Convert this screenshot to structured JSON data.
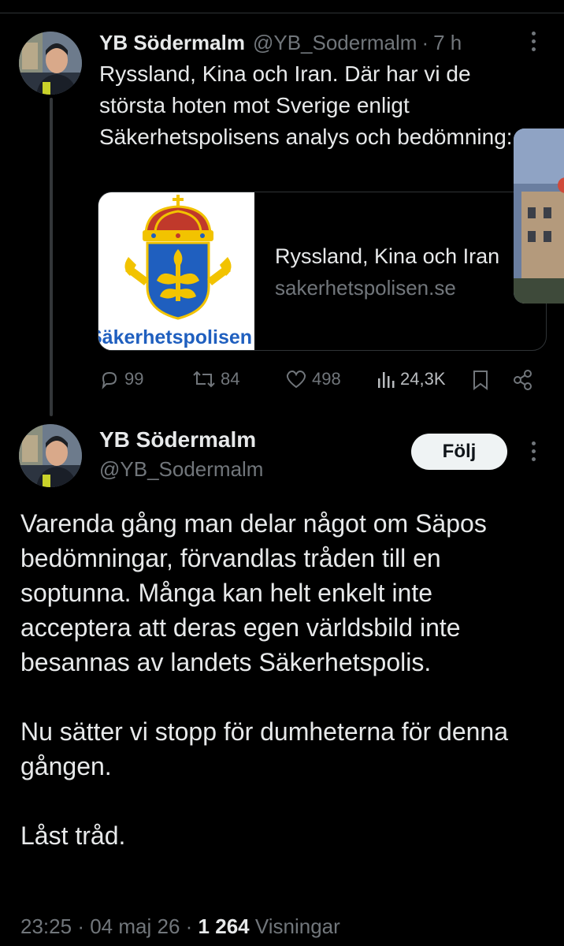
{
  "first_tweet": {
    "author_name": "YB Södermalm",
    "author_handle": "@YB_Sodermalm",
    "separator": "·",
    "time": "7 h",
    "text": "Ryssland, Kina och Iran. Där har vi de största hoten mot Sverige enligt Säkerhetspolisens analys och bedömning:",
    "card": {
      "title": "Ryssland, Kina och Iran",
      "domain": "sakerhetspolisen.se",
      "logo_text": "Säkerhetspolisen",
      "logo_colors": {
        "crown": "#c0392b",
        "gold": "#f2c300",
        "shield": "#1f5fbf"
      }
    },
    "actions": {
      "replies": "99",
      "reposts": "84",
      "likes": "498",
      "views": "24,3K"
    }
  },
  "second_tweet": {
    "author_name": "YB Södermalm",
    "author_handle": "@YB_Sodermalm",
    "follow_label": "Följ",
    "paragraphs": [
      "Varenda gång man delar något om Säpos bedömningar, förvandlas tråden till en soptunna. Många kan helt enkelt inte acceptera att deras egen världsbild inte besannas av landets Säkerhetspolis.",
      "Nu sätter vi stopp för dumheterna för denna gången.",
      "Låst tråd."
    ],
    "meta": {
      "time": "23:25",
      "date": "04 maj 26",
      "separator": "·",
      "views_count": "1 264",
      "views_label": "Visningar"
    }
  },
  "colors": {
    "background": "#000000",
    "text_primary": "#e7e9ea",
    "text_secondary": "#71767b",
    "divider": "#2f3336",
    "follow_button_bg": "#eff3f4"
  }
}
